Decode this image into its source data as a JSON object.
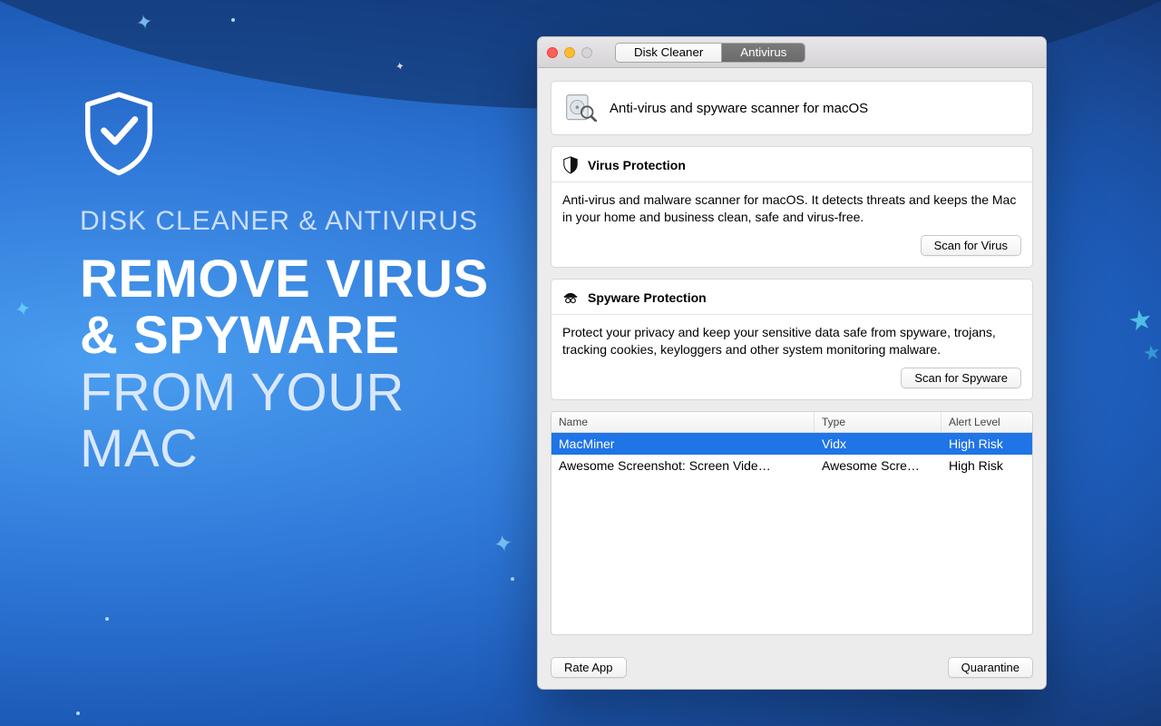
{
  "promo": {
    "subtitle": "DISK CLEANER & ANTIVIRUS",
    "headline_bold": "REMOVE VIRUS & SPYWARE",
    "headline_light": "FROM YOUR MAC"
  },
  "window": {
    "tabs": {
      "disk": "Disk Cleaner",
      "antivirus": "Antivirus",
      "active": "antivirus"
    },
    "intro_text": "Anti-virus and spyware scanner for macOS",
    "virus": {
      "title": "Virus Protection",
      "desc": "Anti-virus and malware scanner for macOS. It detects threats and keeps the Mac in your home and business clean, safe and virus-free.",
      "button": "Scan for Virus"
    },
    "spyware": {
      "title": "Spyware Protection",
      "desc": "Protect your privacy and keep your sensitive data safe from spyware, trojans, tracking cookies, keyloggers and other system monitoring malware.",
      "button": "Scan for Spyware"
    },
    "table": {
      "columns": {
        "name": "Name",
        "type": "Type",
        "alert": "Alert Level"
      },
      "rows": [
        {
          "name": "MacMiner",
          "type": "Vidx",
          "alert": "High Risk",
          "selected": true
        },
        {
          "name": "Awesome Screenshot: Screen Vide…",
          "type": "Awesome Scre…",
          "alert": "High Risk",
          "selected": false
        }
      ]
    },
    "footer": {
      "rate": "Rate App",
      "quarantine": "Quarantine"
    }
  }
}
